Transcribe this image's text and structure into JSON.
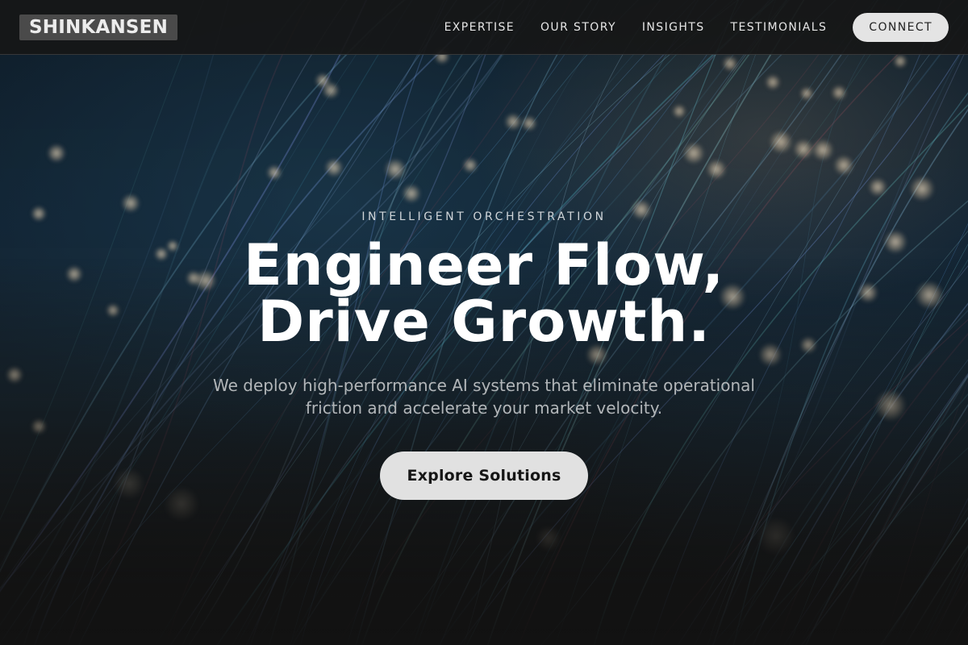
{
  "brand": {
    "logo_text": "SHINKANSEN"
  },
  "nav": {
    "links": [
      "EXPERTISE",
      "OUR STORY",
      "INSIGHTS",
      "TESTIMONIALS"
    ],
    "cta_label": "CONNECT"
  },
  "hero": {
    "eyebrow": "INTELLIGENT ORCHESTRATION",
    "headline_line1": "Engineer Flow,",
    "headline_line2": "Drive Growth.",
    "subtitle": "We deploy high-performance AI systems that eliminate operational friction and accelerate your market velocity.",
    "cta_label": "Explore Solutions"
  },
  "colors": {
    "nav_background": "#161616",
    "logo_background": "#4a4a4a",
    "button_background": "#e1e1e1",
    "headline": "#ffffff",
    "subtitle": "#b2b6b9"
  },
  "icons": [
    "background-fiber-optic-image"
  ]
}
